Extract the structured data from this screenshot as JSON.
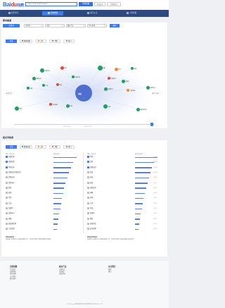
{
  "header": {
    "logo_main": "Bai",
    "logo_accent": "du",
    "logo_suffix": "指数",
    "search_placeholder": "请输入您要查询的关键词",
    "search_button": "查看指数",
    "compare_button": "添加对比",
    "more_button": "趋势研究"
  },
  "nav": {
    "items": [
      {
        "label": "趋势研究",
        "active": false
      },
      {
        "label": "需求图谱",
        "active": true
      },
      {
        "label": "资讯关注",
        "active": false
      },
      {
        "label": "人群画像",
        "active": false
      }
    ]
  },
  "graph": {
    "title": "需求图谱",
    "keyword_tag": "关键词",
    "filters": [
      "关键词",
      "全部",
      "最近7天",
      "PC+移动"
    ],
    "apply_button": "确定",
    "legend": [
      "全部",
      "搜索指数",
      "上升",
      "下降",
      "热门"
    ],
    "center_term": "流感",
    "left_label": "相关词",
    "right_label": "相关词",
    "nodes": [
      {
        "label": "流感症状",
        "color": "#1aa260"
      },
      {
        "label": "甲流",
        "color": "#e04b3a"
      },
      {
        "label": "流感疫苗",
        "color": "#1aa260"
      },
      {
        "label": "流感病毒",
        "color": "#1aa260"
      },
      {
        "label": "发烧",
        "color": "#f08c2b"
      },
      {
        "label": "感冒",
        "color": "#1aa260"
      },
      {
        "label": "咳嗽",
        "color": "#1aa260"
      },
      {
        "label": "流感治疗",
        "color": "#e04b3a"
      },
      {
        "label": "流感药",
        "color": "#1aa260"
      },
      {
        "label": "病毒",
        "color": "#1aa260"
      },
      {
        "label": "乙流",
        "color": "#1aa260"
      },
      {
        "label": "退烧",
        "color": "#e04b3a"
      },
      {
        "label": "流感季节",
        "color": "#1aa260"
      },
      {
        "label": "儿童流感",
        "color": "#f08c2b"
      },
      {
        "label": "流感传染",
        "color": "#1aa260"
      },
      {
        "label": "预防",
        "color": "#1aa260"
      },
      {
        "label": "疫苗接种",
        "color": "#e04b3a"
      },
      {
        "label": "体温",
        "color": "#1aa260"
      },
      {
        "label": "高烧",
        "color": "#1aa260"
      },
      {
        "label": "流感潜伏期",
        "color": "#1aa260"
      }
    ],
    "slider_start": "2023-10-16",
    "slider_end": "2023-10-22"
  },
  "ranking": {
    "title": "相关词热度",
    "tabs": [
      "全部",
      "搜索热度",
      "上升",
      "下降",
      "热门"
    ],
    "left_header": [
      "排名",
      "相关词",
      "搜索热度"
    ],
    "right_header": [
      "排名",
      "相关词",
      "搜索变化率"
    ],
    "left_rows": [
      {
        "rank": "1",
        "term": "流感症状",
        "pct": 0.96
      },
      {
        "rank": "2",
        "term": "流感病毒",
        "pct": 0.82
      },
      {
        "rank": "3",
        "term": "甲流症状",
        "pct": 0.74
      },
      {
        "rank": "4",
        "term": "流感疫苗的副作用",
        "pct": 0.66
      },
      {
        "rank": "5",
        "term": "流感疫苗",
        "pct": 0.58
      },
      {
        "rank": "6",
        "term": "流感治疗",
        "pct": 0.5
      },
      {
        "rank": "7",
        "term": "感冒",
        "pct": 0.44
      },
      {
        "rank": "8",
        "term": "发烧",
        "pct": 0.4
      },
      {
        "rank": "9",
        "term": "甲流",
        "pct": 0.36
      },
      {
        "rank": "10",
        "term": "乙流",
        "pct": 0.32
      },
      {
        "rank": "11",
        "term": "流感药",
        "pct": 0.28
      },
      {
        "rank": "12",
        "term": "流感季节",
        "pct": 0.24
      },
      {
        "rank": "13",
        "term": "咳嗽",
        "pct": 0.2
      },
      {
        "rank": "14",
        "term": "流感潜伏期",
        "pct": 0.17
      },
      {
        "rank": "15",
        "term": "儿童流感",
        "pct": 0.14
      }
    ],
    "right_rows": [
      {
        "rank": "1",
        "term": "甲流",
        "pct": 0.95,
        "val": "+260%"
      },
      {
        "rank": "2",
        "term": "流感",
        "pct": 0.8,
        "val": "+180%"
      },
      {
        "rank": "3",
        "term": "流感疫苗",
        "pct": 0.72,
        "val": "+150%"
      },
      {
        "rank": "4",
        "term": "高烧",
        "pct": 0.64,
        "val": "+120%"
      },
      {
        "rank": "5",
        "term": "发烧",
        "pct": 0.58,
        "val": "+96%"
      },
      {
        "rank": "6",
        "term": "退烧",
        "pct": 0.52,
        "val": "+80%"
      },
      {
        "rank": "7",
        "term": "流感症状",
        "pct": 0.46,
        "val": "+66%"
      },
      {
        "rank": "8",
        "term": "咳嗽",
        "pct": 0.4,
        "val": "+54%"
      },
      {
        "rank": "9",
        "term": "病毒",
        "pct": 0.36,
        "val": "+45%"
      },
      {
        "rank": "10",
        "term": "乙流",
        "pct": 0.32,
        "val": "+40%"
      },
      {
        "rank": "11",
        "term": "体温",
        "pct": 0.28,
        "val": "+35%"
      },
      {
        "rank": "12",
        "term": "流感药",
        "pct": 0.24,
        "val": "+30%"
      },
      {
        "rank": "13",
        "term": "预防",
        "pct": 0.2,
        "val": "+26%"
      },
      {
        "rank": "14",
        "term": "流感传染",
        "pct": 0.17,
        "val": "+22%"
      },
      {
        "rank": "15",
        "term": "疫苗接种",
        "pct": 0.14,
        "val": "+18%"
      }
    ],
    "note_left_title": "搜索热度说明",
    "note_left": "反映用户在搜索中心词相关搜索汇总，并综合计算汇总得出的相关词热度。",
    "note_right_title": "搜索变化率说明",
    "note_right": "反映用户在搜索中心词相关搜索汇总，并综合计算汇总得出的相关词变化率。"
  },
  "footer": {
    "col1_title": "百度指数",
    "col1": [
      "产品简介",
      "使用帮助",
      "常见问题",
      "关于我们",
      "联系我们"
    ],
    "col2_title": "相关产品",
    "col2": [
      "百度统计",
      "百度推广",
      "百度营销"
    ],
    "col3_title": "关注我们",
    "col3": [
      "微博",
      "微信"
    ],
    "copyright": "©2024 Baidu 使用百度前必读 隐私政策 京ICP证030173号"
  },
  "colors": {
    "accent": "#3f7ce8",
    "nav": "#2d4a7e",
    "green": "#1aa260",
    "red": "#e04b3a",
    "orange": "#f08c2b"
  }
}
